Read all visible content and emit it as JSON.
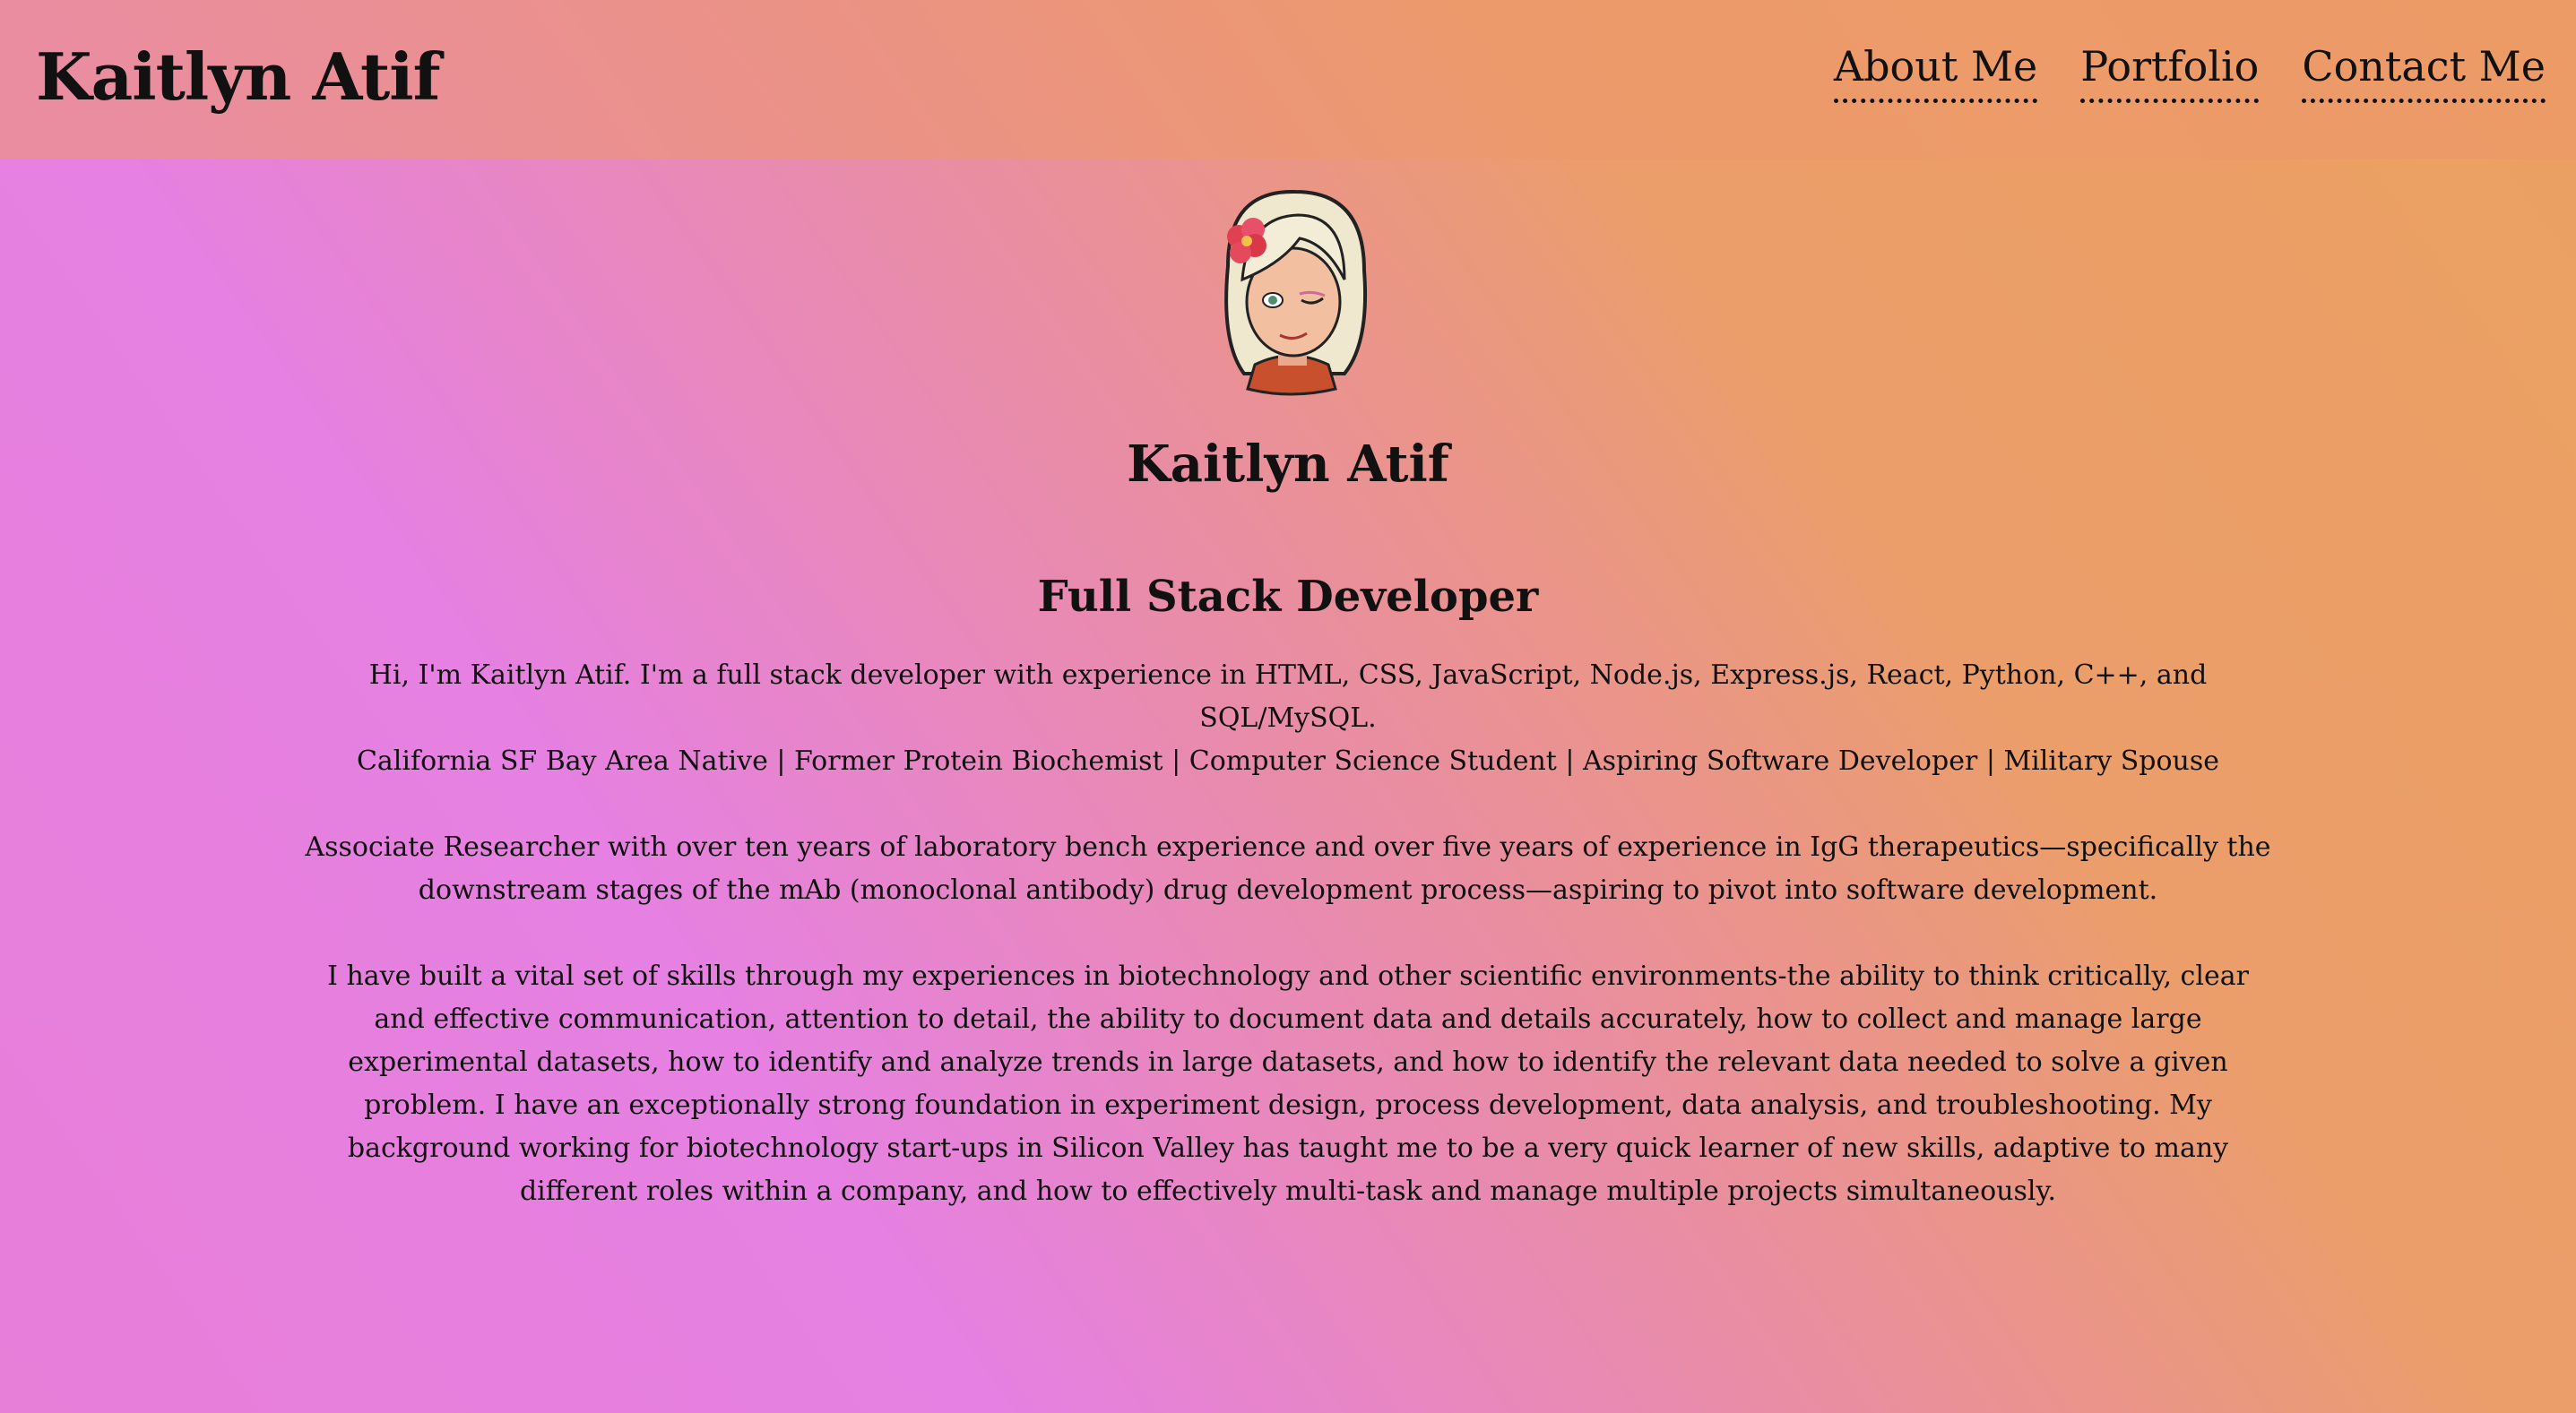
{
  "header": {
    "site_title": "Kaitlyn Atif",
    "nav": [
      "About Me",
      "Portfolio",
      "Contact Me"
    ]
  },
  "profile": {
    "avatar_icon": "bitmoji-avatar",
    "name": "Kaitlyn Atif",
    "role": "Full Stack Developer",
    "intro_line_1": "Hi, I'm Kaitlyn Atif. I'm a full stack developer with experience in HTML, CSS, JavaScript, Node.js, Express.js, React, Python, C++, and SQL/MySQL.",
    "intro_line_2": "California SF Bay Area Native | Former Protein Biochemist | Computer Science Student | Aspiring Software Developer | Military Spouse",
    "paragraph_2": "Associate Researcher with over ten years of laboratory bench experience and over five years of experience in IgG therapeutics—specifically the downstream stages of the mAb (monoclonal antibody) drug development process—aspiring to pivot into software development.",
    "paragraph_3": "I have built a vital set of skills through my experiences in biotechnology and other scientific environments-the ability to think critically, clear and effective communication, attention to detail, the ability to document data and details accurately, how to collect and manage large experimental datasets, how to identify and analyze trends in large datasets, and how to identify the relevant data needed to solve a given problem. I have an exceptionally strong foundation in experiment design, process development, data analysis, and troubleshooting. My background working for biotechnology start-ups in Silicon Valley has taught me to be a very quick learner of new skills, adaptive to many different roles within a company, and how to effectively multi-task and manage multiple projects simultaneously."
  }
}
